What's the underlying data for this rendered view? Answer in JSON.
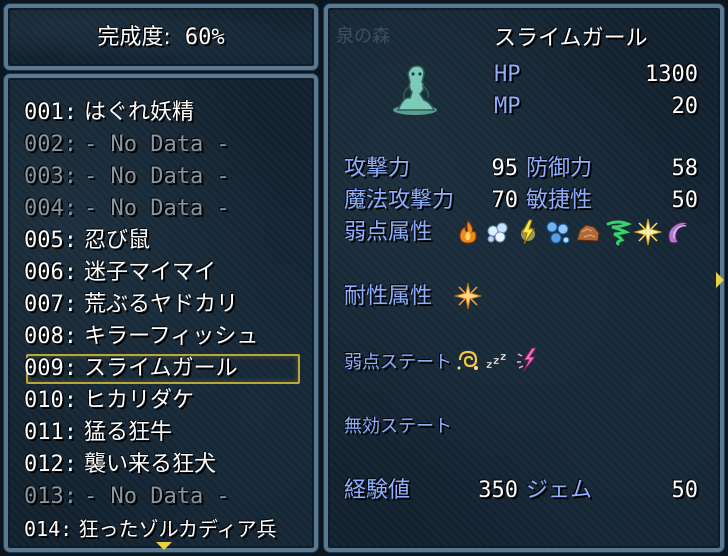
{
  "progress": {
    "label": "完成度:",
    "value": "60%"
  },
  "list": {
    "items": [
      {
        "num": "001:",
        "name": "はぐれ妖精",
        "known": true
      },
      {
        "num": "002:",
        "name": "- No Data -",
        "known": false
      },
      {
        "num": "003:",
        "name": "- No Data -",
        "known": false
      },
      {
        "num": "004:",
        "name": "- No Data -",
        "known": false
      },
      {
        "num": "005:",
        "name": "忍び鼠",
        "known": true
      },
      {
        "num": "006:",
        "name": "迷子マイマイ",
        "known": true
      },
      {
        "num": "007:",
        "name": "荒ぶるヤドカリ",
        "known": true
      },
      {
        "num": "008:",
        "name": "キラーフィッシュ",
        "known": true
      },
      {
        "num": "009:",
        "name": "スライムガール",
        "known": true
      },
      {
        "num": "010:",
        "name": "ヒカリダケ",
        "known": true
      },
      {
        "num": "011:",
        "name": "猛る狂牛",
        "known": true
      },
      {
        "num": "012:",
        "name": "襲い来る狂犬",
        "known": true
      },
      {
        "num": "013:",
        "name": "- No Data -",
        "known": false
      },
      {
        "num": "014:",
        "name": "狂ったゾルカディア兵",
        "known": true
      }
    ],
    "selected_index": 8
  },
  "detail": {
    "location_ghost": "泉の森",
    "name": "スライムガール",
    "hp_label": "HP",
    "hp_value": "1300",
    "mp_label": "MP",
    "mp_value": "20",
    "atk_label": "攻撃力",
    "atk_value": "95",
    "def_label": "防御力",
    "def_value": "58",
    "matk_label": "魔法攻撃力",
    "matk_value": "70",
    "agi_label": "敏捷性",
    "agi_value": "50",
    "weak_elem_label": "弱点属性",
    "weak_elem_icons": [
      "fire-icon",
      "ice-icon",
      "thunder-icon",
      "water-icon",
      "earth-icon",
      "wind-icon",
      "light-icon",
      "dark-icon"
    ],
    "resist_elem_label": "耐性属性",
    "resist_elem_icons": [
      "light-icon"
    ],
    "weak_state_label": "弱点ステート",
    "weak_state_icons": [
      "confusion-icon",
      "sleep-icon",
      "paralysis-icon"
    ],
    "immune_state_label": "無効ステート",
    "immune_state_icons": [],
    "exp_label": "経験値",
    "exp_value": "350",
    "gem_label": "ジェム",
    "gem_value": "50"
  },
  "colors": {
    "label_blue": "#8fb0ff",
    "text_white": "#ffffff",
    "text_gray": "#8c96a0",
    "cursor": "#b8a83a",
    "arrow": "#e8d040",
    "frame": "#5a7890"
  }
}
